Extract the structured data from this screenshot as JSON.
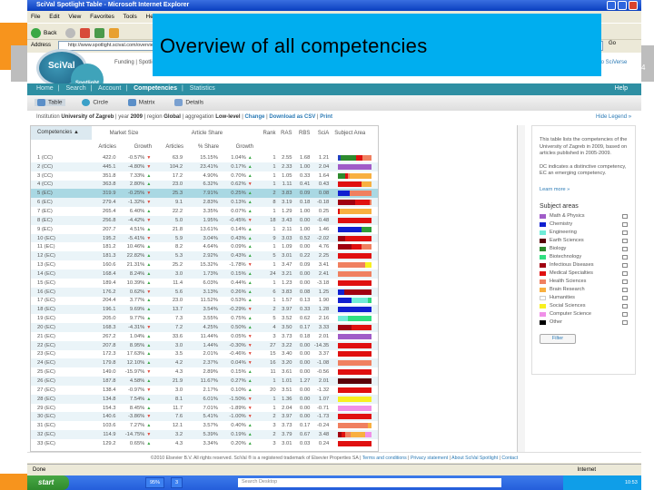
{
  "slide": {
    "title": "Overview of all competencies",
    "number": "4"
  },
  "browser": {
    "title": "SciVal Spotlight  Table - Microsoft Internet Explorer",
    "menu": [
      "File",
      "Edit",
      "View",
      "Favorites",
      "Tools",
      "Help"
    ],
    "back": "Back",
    "address_label": "Address",
    "url": "http://www.spotlight.scival.com/overview",
    "go": "Go",
    "status": "Done",
    "zone": "Internet"
  },
  "site": {
    "logo": "SciVal",
    "logo_sub": "Spotlight",
    "top_links": "Funding | Spotlight",
    "scival_link": "to SciVerse",
    "nav": [
      "Home",
      "Search",
      "Account",
      "Competencies",
      "Statistics"
    ],
    "help": "Help",
    "subtabs": [
      "Table",
      "Circle",
      "Matrix",
      "Details"
    ],
    "filter": {
      "inst_label": "Institution",
      "inst": "University of Zagreb",
      "year_label": "year",
      "year": "2009",
      "region_label": "region",
      "region": "Global",
      "agg_label": "aggregation",
      "agg": "Low-level",
      "change": "Change",
      "csv": "Download as CSV",
      "print": "Print"
    },
    "hide_legend": "Hide Legend »"
  },
  "table": {
    "headers": {
      "comp": "Competencies ▲",
      "market": "Market Size",
      "share": "Article Share",
      "rank": "Rank",
      "ras": "RAS",
      "rbs": "RBS",
      "scia": "SciA",
      "subject": "Subject Area",
      "articles": "Articles",
      "growth": "Growth",
      "articles2": "Articles",
      "pct": "% Share",
      "growth2": "Growth"
    },
    "rows": [
      [
        "1 (CC)",
        "422.0",
        "-0.57%",
        "d",
        "63.9",
        "15.15%",
        "1.04%",
        "u",
        "1",
        "2.55",
        "1.68",
        "1.21",
        [
          [
            "#1f3fbf",
            8
          ],
          [
            "#2e8b2e",
            45
          ],
          [
            "#e01010",
            20
          ],
          [
            "#f08060",
            27
          ]
        ]
      ],
      [
        "2 (CC)",
        "445.1",
        "-4.80%",
        "d",
        "104.2",
        "23.41%",
        "0.17%",
        "u",
        "1",
        "2.33",
        "1.00",
        "2.04",
        [
          [
            "#a05cc8",
            100
          ]
        ]
      ],
      [
        "3 (CC)",
        "351.8",
        "7.33%",
        "u",
        "17.2",
        "4.90%",
        "0.70%",
        "u",
        "1",
        "1.05",
        "0.33",
        "1.64",
        [
          [
            "#2e8b2e",
            20
          ],
          [
            "#e01010",
            8
          ],
          [
            "#f08060",
            8
          ],
          [
            "#f8b040",
            64
          ]
        ]
      ],
      [
        "4 (CC)",
        "363.8",
        "2.80%",
        "u",
        "23.0",
        "6.32%",
        "0.62%",
        "d",
        "1",
        "1.11",
        "0.41",
        "0.43",
        [
          [
            "#e01010",
            70
          ],
          [
            "#f8b040",
            30
          ]
        ]
      ],
      [
        "5 (EC)",
        "319.9",
        "-0.25%",
        "d",
        "25.3",
        "7.91%",
        "0.25%",
        "u",
        "2",
        "3.83",
        "0.09",
        "0.08",
        [
          [
            "#1020d0",
            35
          ],
          [
            "#f08060",
            65
          ]
        ]
      ],
      [
        "6 (EC)",
        "279.4",
        "-1.32%",
        "d",
        "9.1",
        "2.83%",
        "0.13%",
        "u",
        "8",
        "3.19",
        "0.18",
        "-0.18",
        [
          [
            "#a00010",
            50
          ],
          [
            "#e01010",
            45
          ],
          [
            "#f08060",
            5
          ]
        ]
      ],
      [
        "7 (EC)",
        "265.4",
        "6.40%",
        "u",
        "22.2",
        "3.35%",
        "0.07%",
        "u",
        "1",
        "1.29",
        "1.00",
        "0.25",
        [
          [
            "#e01010",
            6
          ],
          [
            "#f8b040",
            94
          ]
        ]
      ],
      [
        "8 (EC)",
        "256.8",
        "-4.42%",
        "d",
        "5.0",
        "1.95%",
        "-0.45%",
        "d",
        "18",
        "3.43",
        "0.00",
        "-0.48",
        [
          [
            "#e01010",
            100
          ]
        ]
      ],
      [
        "9 (EC)",
        "207.7",
        "4.51%",
        "u",
        "21.8",
        "13.61%",
        "0.14%",
        "u",
        "1",
        "2.11",
        "1.00",
        "1.46",
        [
          [
            "#1020d0",
            70
          ],
          [
            "#2e9e3a",
            30
          ]
        ]
      ],
      [
        "10 (EC)",
        "195.2",
        "-5.41%",
        "d",
        "5.9",
        "3.04%",
        "0.43%",
        "u",
        "9",
        "3.03",
        "0.52",
        "-2.02",
        [
          [
            "#a00010",
            20
          ],
          [
            "#e01010",
            80
          ]
        ]
      ],
      [
        "11 (EC)",
        "181.2",
        "10.46%",
        "u",
        "8.2",
        "4.64%",
        "0.09%",
        "u",
        "1",
        "1.09",
        "0.00",
        "4.76",
        [
          [
            "#a00010",
            40
          ],
          [
            "#e01010",
            30
          ],
          [
            "#f08060",
            30
          ]
        ]
      ],
      [
        "12 (EC)",
        "181.3",
        "22.82%",
        "u",
        "5.3",
        "2.92%",
        "0.43%",
        "u",
        "5",
        "3.01",
        "0.22",
        "2.25",
        [
          [
            "#e01010",
            100
          ]
        ]
      ],
      [
        "13 (EC)",
        "160.6",
        "21.31%",
        "u",
        "25.2",
        "15.32%",
        "-1.78%",
        "d",
        "1",
        "3.47",
        "0.09",
        "3.41",
        [
          [
            "#f08060",
            80
          ],
          [
            "#f8f020",
            20
          ]
        ]
      ],
      [
        "14 (EC)",
        "168.4",
        "8.24%",
        "u",
        "3.0",
        "1.73%",
        "0.15%",
        "u",
        "24",
        "3.21",
        "0.00",
        "2.41",
        [
          [
            "#f08060",
            100
          ]
        ]
      ],
      [
        "15 (EC)",
        "189.4",
        "10.39%",
        "u",
        "11.4",
        "6.03%",
        "0.44%",
        "u",
        "1",
        "1.23",
        "0.00",
        "-3.18",
        [
          [
            "#e01010",
            100
          ]
        ]
      ],
      [
        "16 (EC)",
        "176.2",
        "0.62%",
        "d",
        "5.6",
        "3.13%",
        "0.26%",
        "u",
        "6",
        "3.83",
        "0.08",
        "1.25",
        [
          [
            "#1020d0",
            18
          ],
          [
            "#a00010",
            82
          ]
        ]
      ],
      [
        "17 (EC)",
        "204.4",
        "3.77%",
        "u",
        "23.0",
        "11.52%",
        "0.53%",
        "u",
        "1",
        "1.57",
        "0.13",
        "1.90",
        [
          [
            "#1020d0",
            40
          ],
          [
            "#70ecd8",
            48
          ],
          [
            "#30d880",
            12
          ]
        ]
      ],
      [
        "18 (EC)",
        "196.1",
        "9.69%",
        "u",
        "13.7",
        "3.54%",
        "-0.29%",
        "d",
        "2",
        "3.97",
        "0.33",
        "1.28",
        [
          [
            "#1020d0",
            100
          ]
        ]
      ],
      [
        "19 (EC)",
        "205.0",
        "9.77%",
        "u",
        "7.3",
        "3.55%",
        "0.75%",
        "u",
        "5",
        "3.52",
        "0.62",
        "2.16",
        [
          [
            "#70ecd8",
            30
          ],
          [
            "#30e080",
            70
          ]
        ]
      ],
      [
        "20 (EC)",
        "168.3",
        "-4.31%",
        "d",
        "7.2",
        "4.25%",
        "0.50%",
        "u",
        "4",
        "3.50",
        "0.17",
        "3.33",
        [
          [
            "#a00010",
            40
          ],
          [
            "#e01010",
            60
          ]
        ]
      ],
      [
        "21 (EC)",
        "267.2",
        "1.04%",
        "u",
        "33.6",
        "11.44%",
        "0.05%",
        "d",
        "3",
        "3.73",
        "0.18",
        "2.01",
        [
          [
            "#a05cc8",
            100
          ]
        ]
      ],
      [
        "22 (EC)",
        "207.8",
        "8.95%",
        "u",
        "3.0",
        "1.44%",
        "-0.30%",
        "d",
        "27",
        "3.22",
        "0.00",
        "-14.35",
        [
          [
            "#e01010",
            100
          ]
        ]
      ],
      [
        "23 (EC)",
        "172.3",
        "17.63%",
        "u",
        "3.5",
        "2.01%",
        "-0.46%",
        "d",
        "15",
        "3.40",
        "0.00",
        "3.37",
        [
          [
            "#e01010",
            100
          ]
        ]
      ],
      [
        "24 (EC)",
        "179.8",
        "12.10%",
        "u",
        "4.2",
        "2.37%",
        "0.04%",
        "d",
        "16",
        "3.20",
        "0.00",
        "-1.08",
        [
          [
            "#f08060",
            100
          ]
        ]
      ],
      [
        "25 (EC)",
        "149.0",
        "-15.97%",
        "d",
        "4.3",
        "2.89%",
        "0.15%",
        "u",
        "11",
        "3.61",
        "0.00",
        "-0.56",
        [
          [
            "#e01010",
            100
          ]
        ]
      ],
      [
        "26 (EC)",
        "187.8",
        "4.58%",
        "u",
        "21.9",
        "11.67%",
        "0.27%",
        "u",
        "1",
        "1.01",
        "1.27",
        "2.01",
        [
          [
            "#5a0008",
            100
          ]
        ]
      ],
      [
        "27 (EC)",
        "138.4",
        "-0.97%",
        "d",
        "3.0",
        "2.17%",
        "0.10%",
        "u",
        "20",
        "3.51",
        "0.00",
        "-1.32",
        [
          [
            "#e01010",
            100
          ]
        ]
      ],
      [
        "28 (EC)",
        "134.8",
        "7.54%",
        "u",
        "8.1",
        "6.01%",
        "-1.50%",
        "d",
        "1",
        "1.36",
        "0.00",
        "1.07",
        [
          [
            "#f8f020",
            100
          ]
        ]
      ],
      [
        "29 (EC)",
        "154.3",
        "8.45%",
        "u",
        "11.7",
        "7.01%",
        "-1.89%",
        "d",
        "1",
        "2.04",
        "0.00",
        "-0.71",
        [
          [
            "#f090e8",
            100
          ]
        ]
      ],
      [
        "30 (EC)",
        "140.6",
        "-3.86%",
        "d",
        "7.6",
        "5.41%",
        "-1.00%",
        "d",
        "2",
        "3.97",
        "0.00",
        "-1.73",
        [
          [
            "#e01010",
            100
          ]
        ]
      ],
      [
        "31 (EC)",
        "103.6",
        "7.27%",
        "u",
        "12.1",
        "3.57%",
        "0.40%",
        "u",
        "3",
        "3.73",
        "0.17",
        "-0.24",
        [
          [
            "#f08060",
            90
          ],
          [
            "#f8b040",
            10
          ]
        ]
      ],
      [
        "32 (EC)",
        "114.9",
        "-14.75%",
        "d",
        "3.2",
        "5.39%",
        "0.19%",
        "u",
        "2",
        "3.79",
        "0.67",
        "3.48",
        [
          [
            "#a00010",
            10
          ],
          [
            "#e01010",
            12
          ],
          [
            "#f08060",
            15
          ],
          [
            "#f8b040",
            45
          ],
          [
            "#f090e8",
            18
          ]
        ]
      ],
      [
        "33 (EC)",
        "129.2",
        "0.65%",
        "u",
        "4.3",
        "3.34%",
        "0.20%",
        "u",
        "3",
        "3.01",
        "0.03",
        "0.24",
        [
          [
            "#e01010",
            100
          ]
        ]
      ]
    ]
  },
  "legend": {
    "desc1": "This table lists the competencies of the University of Zagreb in 2009, based on articles published in 2005-2009.",
    "desc2": "DC indicates a distinctive competency, EC an emerging competency.",
    "learn_more": "Learn more »",
    "title": "Subject areas",
    "items": [
      {
        "label": "Math & Physics",
        "color": "#a05cc8"
      },
      {
        "label": "Chemistry",
        "color": "#1020d0"
      },
      {
        "label": "Engineering",
        "color": "#70ecd8"
      },
      {
        "label": "Earth Sciences",
        "color": "#5a0008"
      },
      {
        "label": "Biology",
        "color": "#2e8b2e"
      },
      {
        "label": "Biotechnology",
        "color": "#30e080"
      },
      {
        "label": "Infectious Diseases",
        "color": "#a00010"
      },
      {
        "label": "Medical Specialties",
        "color": "#e01010"
      },
      {
        "label": "Health Sciences",
        "color": "#f08060"
      },
      {
        "label": "Brain Research",
        "color": "#f8b040"
      },
      {
        "label": "Humanities",
        "color": "#ffffff"
      },
      {
        "label": "Social Sciences",
        "color": "#f8f020"
      },
      {
        "label": "Computer Science",
        "color": "#f090e8"
      },
      {
        "label": "Other",
        "color": "#000000"
      }
    ],
    "filter": "Filter"
  },
  "footer": {
    "copy": "©2010 Elsevier B.V. All rights reserved. SciVal ® is a registered trademark of Elsevier Properties SA",
    "links": [
      "Terms and conditions",
      "Privacy statement",
      "About SciVal Spotlight",
      "Contact"
    ]
  },
  "taskbar": {
    "start": "start",
    "tasks": [
      "95%",
      "3"
    ],
    "search": "Search Desktop",
    "clock": "10:53"
  }
}
